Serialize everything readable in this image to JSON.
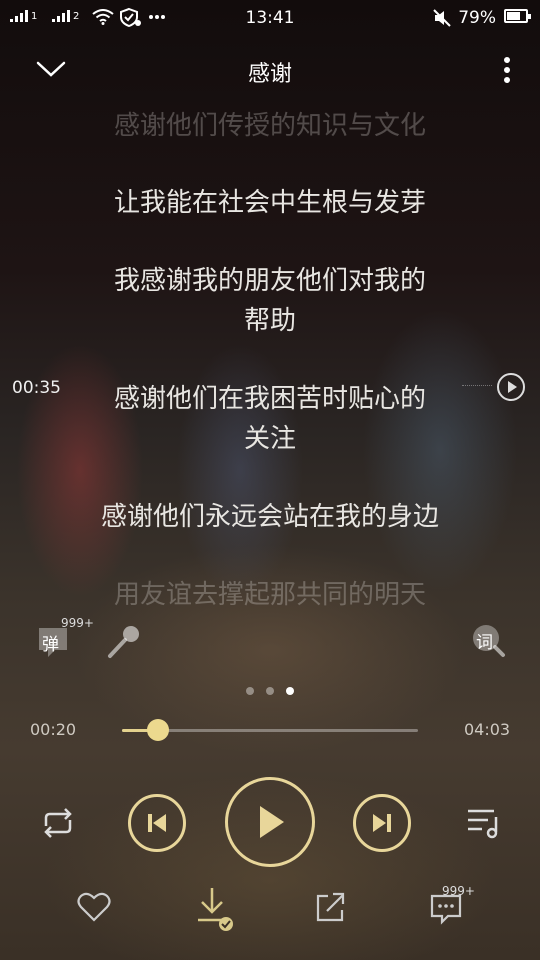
{
  "status_bar": {
    "sim1_label": "1",
    "sim2_label": "2",
    "time": "13:41",
    "battery_text": "79%",
    "battery_level": 0.79
  },
  "header": {
    "title": "感谢"
  },
  "lyrics": {
    "lines": [
      "感谢他们传授的知识与文化",
      "让我能在社会中生根与发芽",
      "我感谢我的朋友他们对我的",
      "帮助",
      "感谢他们在我困苦时贴心的",
      "关注",
      "感谢他们永远会站在我的身边",
      "用友谊去撑起那共同的明天"
    ],
    "seek_time": "00:35"
  },
  "tools": {
    "danmu_label": "弹",
    "danmu_count": "999+",
    "lyrics_icon_label": "词"
  },
  "progress": {
    "current": "00:20",
    "total": "04:03",
    "fraction": 0.12
  },
  "actions": {
    "comment_count": "999+"
  },
  "colors": {
    "accent": "#e8d69a",
    "progress_fill": "#e4d28e"
  },
  "icons": [
    "chevron-down-icon",
    "more-vertical-icon",
    "play-circle-icon",
    "microphone-icon",
    "repeat-icon",
    "previous-icon",
    "play-icon",
    "next-icon",
    "playlist-icon",
    "heart-icon",
    "download-icon",
    "share-icon",
    "comment-icon"
  ]
}
